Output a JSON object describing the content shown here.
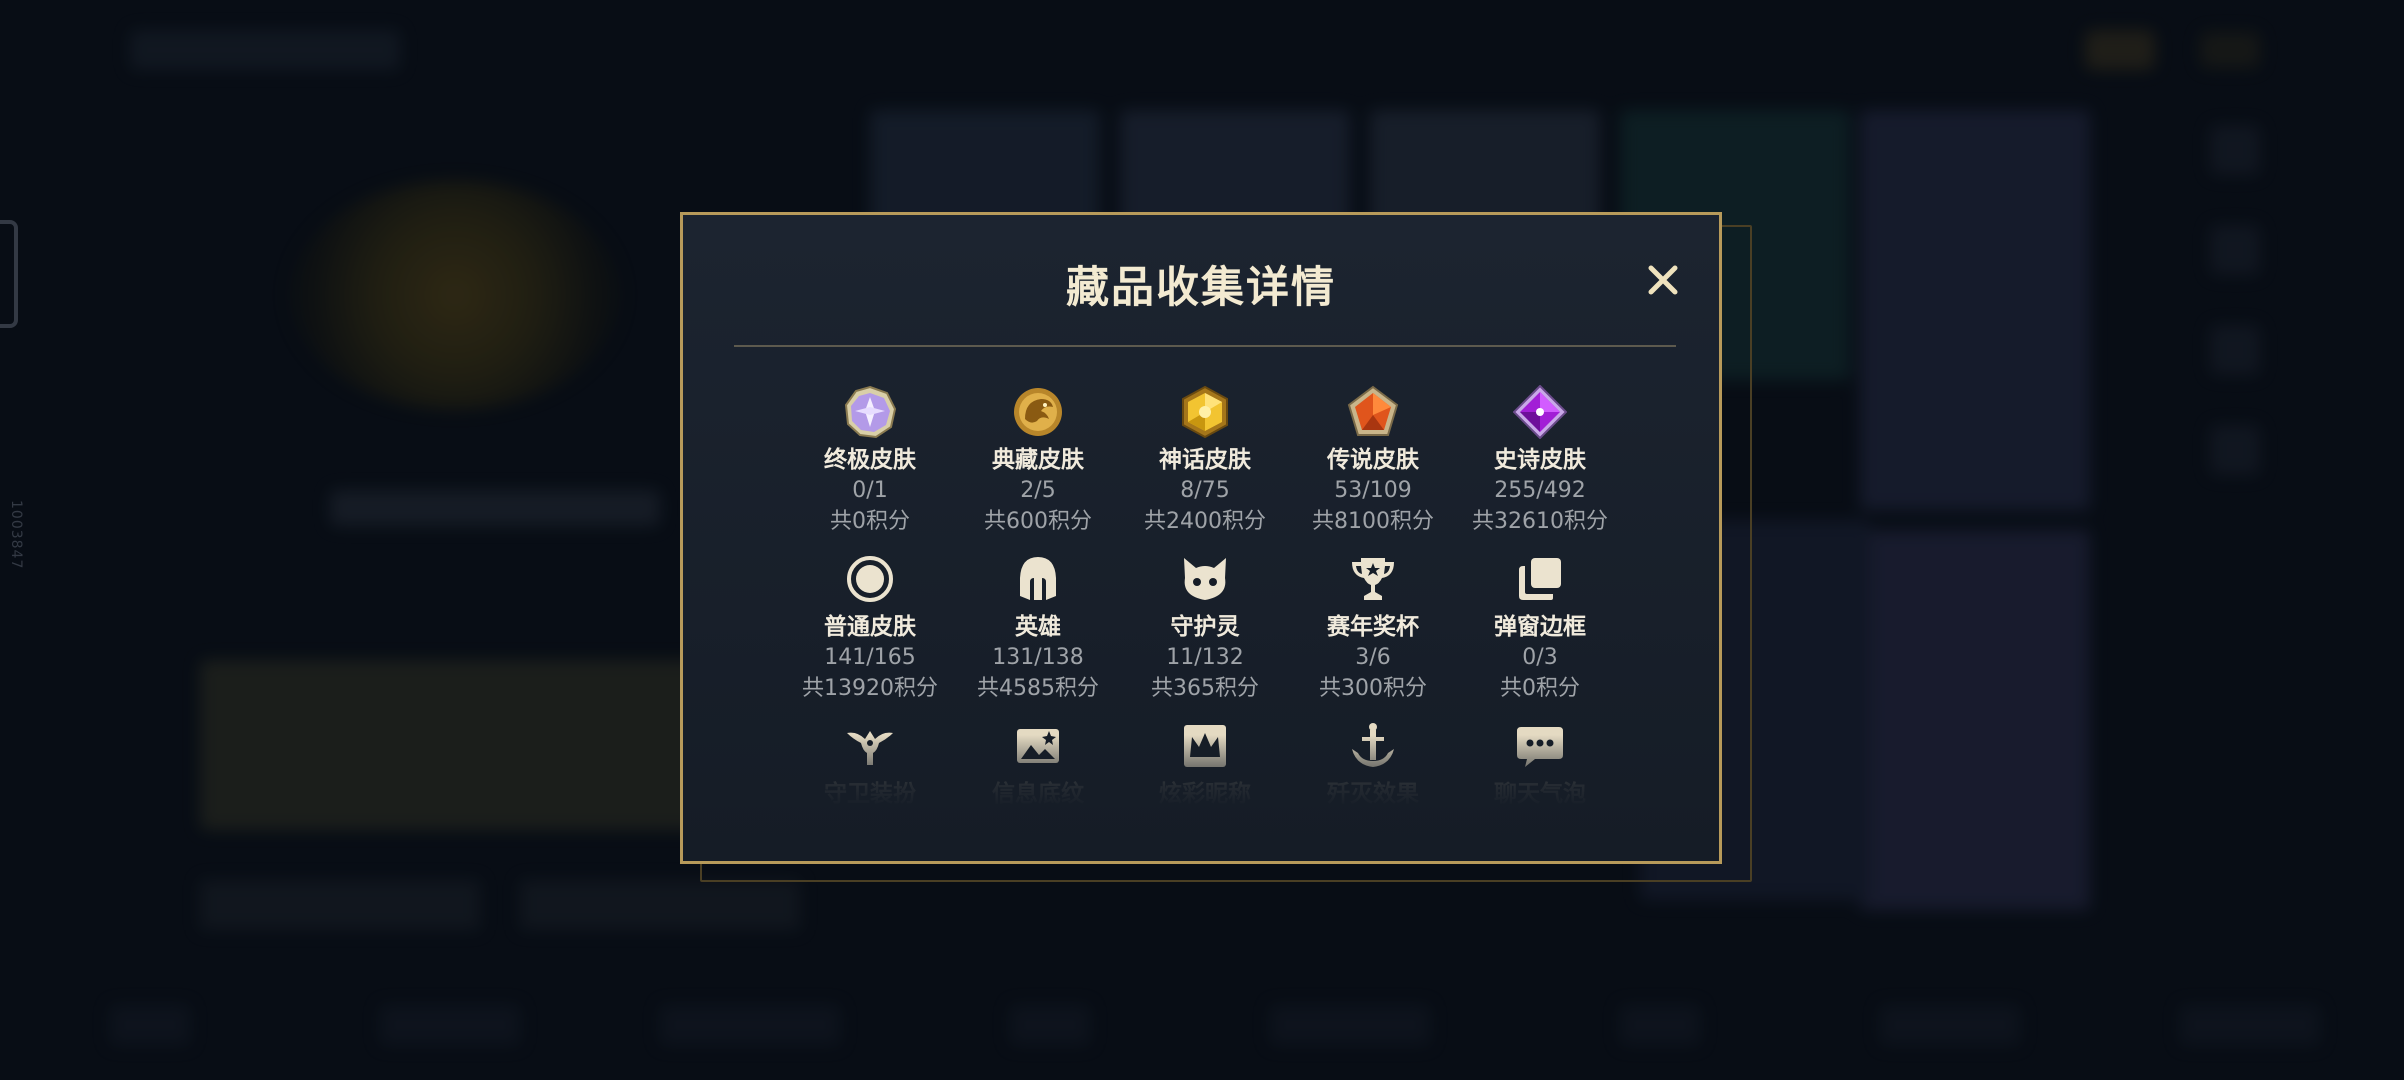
{
  "background": {
    "side_id": "1003847"
  },
  "modal": {
    "title": "藏品收集详情",
    "close_label": "✕",
    "rows": [
      [
        {
          "key": "ultimate",
          "name": "终极皮肤",
          "count": "0/1",
          "points": "共0积分",
          "icon": "ultimate-gem-icon"
        },
        {
          "key": "collector",
          "name": "典藏皮肤",
          "count": "2/5",
          "points": "共600积分",
          "icon": "collector-dragon-icon"
        },
        {
          "key": "mythic",
          "name": "神话皮肤",
          "count": "8/75",
          "points": "共2400积分",
          "icon": "mythic-gem-icon"
        },
        {
          "key": "legendary",
          "name": "传说皮肤",
          "count": "53/109",
          "points": "共8100积分",
          "icon": "legendary-gem-icon"
        },
        {
          "key": "epic",
          "name": "史诗皮肤",
          "count": "255/492",
          "points": "共32610积分",
          "icon": "epic-gem-icon"
        }
      ],
      [
        {
          "key": "common",
          "name": "普通皮肤",
          "count": "141/165",
          "points": "共13920积分",
          "icon": "common-ring-icon"
        },
        {
          "key": "champion",
          "name": "英雄",
          "count": "131/138",
          "points": "共4585积分",
          "icon": "helmet-icon"
        },
        {
          "key": "guardian",
          "name": "守护灵",
          "count": "11/132",
          "points": "共365积分",
          "icon": "guardian-creature-icon"
        },
        {
          "key": "trophy",
          "name": "赛年奖杯",
          "count": "3/6",
          "points": "共300积分",
          "icon": "trophy-icon"
        },
        {
          "key": "frame",
          "name": "弹窗边框",
          "count": "0/3",
          "points": "共0积分",
          "icon": "frame-stack-icon"
        }
      ],
      [
        {
          "key": "ward",
          "name": "守卫装扮",
          "icon": "ward-icon"
        },
        {
          "key": "banner",
          "name": "信息底纹",
          "icon": "banner-image-icon"
        },
        {
          "key": "nickname",
          "name": "炫彩昵称",
          "icon": "crown-card-icon"
        },
        {
          "key": "elimination",
          "name": "歼灭效果",
          "icon": "anchor-icon"
        },
        {
          "key": "chat",
          "name": "聊天气泡",
          "icon": "chat-bubble-icon"
        }
      ]
    ]
  },
  "colors": {
    "accent_gold": "#b79a5a",
    "title_text": "#f3ead1",
    "muted_text": "#9fa3a8",
    "modal_bg": "#18202b"
  }
}
